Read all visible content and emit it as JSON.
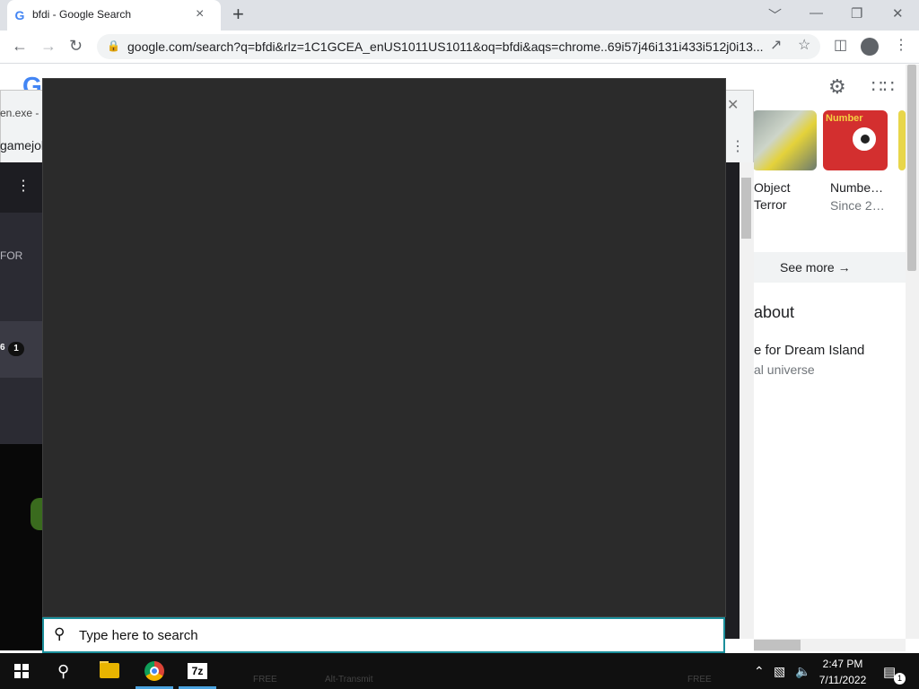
{
  "browser": {
    "tab_icon": "G",
    "tab_title": "bfdi - Google Search",
    "tab_close": "×",
    "new_tab": "+",
    "url": "google.com/search?q=bfdi&rlz=1C1GCEA_enUS1011US1011&oq=bfdi&aqs=chrome..69i57j46i131i433i512j0i13...",
    "window_controls": [
      "﹀",
      "—",
      "❐",
      "✕"
    ]
  },
  "google": {
    "cards": [
      {
        "title_line1": "Object",
        "title_line2": "Terror",
        "subtitle": ""
      },
      {
        "title_line1": "Numbe…",
        "title_line2": "",
        "subtitle": "Since 2…"
      }
    ],
    "numberblocks_logo": "Number",
    "see_more": "See more",
    "about_heading": "about",
    "kp_title": "e for Dream Island",
    "kp_subtitle": "al universe"
  },
  "background_window": {
    "title": "en.exe - G",
    "url": "gamejolt",
    "side_text": "FOR",
    "badge_prefix": "6",
    "badge": "1"
  },
  "search_panel": {
    "placeholder": "Type here to search"
  },
  "taskbar": {
    "sevenzip_label": "7z",
    "time": "2:47 PM",
    "date": "7/11/2022",
    "notification_count": "1",
    "ghost_labels": [
      "FREE",
      "Alt-Transmit",
      "FREE"
    ]
  }
}
